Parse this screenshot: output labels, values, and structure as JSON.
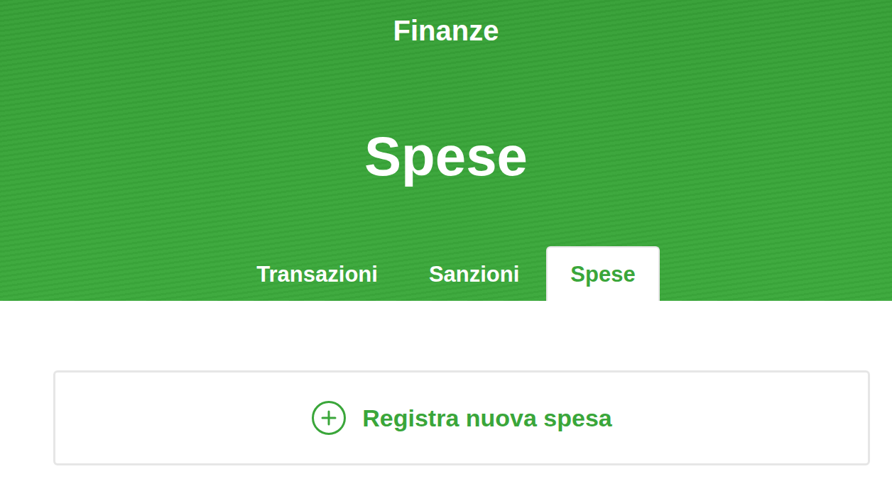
{
  "header": {
    "section": "Finanze",
    "title": "Spese"
  },
  "tabs": [
    {
      "label": "Transazioni",
      "selected": false
    },
    {
      "label": "Sanzioni",
      "selected": false
    },
    {
      "label": "Spese",
      "selected": true
    }
  ],
  "action": {
    "label": "Registra nuova spesa"
  }
}
